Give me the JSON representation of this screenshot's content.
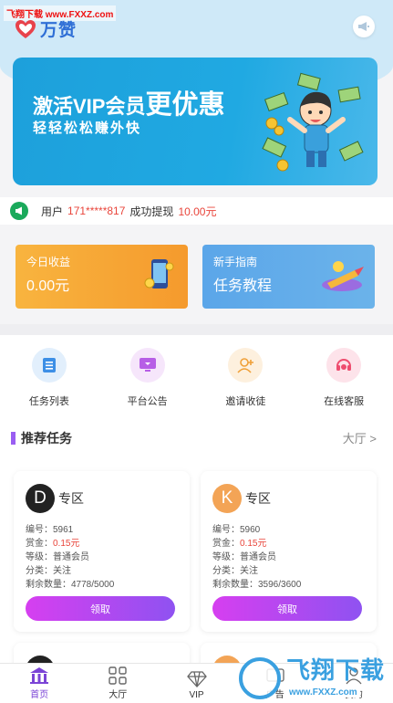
{
  "watermark_top": "飞翔下载 www.FXXZ.com",
  "app": {
    "logo_text": "万赞"
  },
  "banner": {
    "line1_prefix": "激活VIP会员",
    "line1_big": "更优惠",
    "line2": "轻轻松松赚外快"
  },
  "ticker": {
    "user_label": "用户",
    "phone": "171*****817",
    "action": "成功提现",
    "amount": "10.00元"
  },
  "cards": {
    "earnings": {
      "label": "今日收益",
      "value": "0.00元"
    },
    "guide": {
      "label": "新手指南",
      "title": "任务教程"
    }
  },
  "shortcuts": [
    {
      "label": "任务列表",
      "icon": "list-icon",
      "color": "#3d8fe6"
    },
    {
      "label": "平台公告",
      "icon": "monitor-icon",
      "color": "#b75ee6"
    },
    {
      "label": "邀请收徒",
      "icon": "invite-user-icon",
      "color": "#f0a038"
    },
    {
      "label": "在线客服",
      "icon": "headset-icon",
      "color": "#ee4d6f"
    }
  ],
  "recommend": {
    "title": "推荐任务",
    "more": "大厅 >"
  },
  "tasks": [
    {
      "badge": "D",
      "badge_color": "#222222",
      "zone": "专区",
      "id_label": "编号：",
      "id": "5961",
      "reward_label": "赏金：",
      "reward": "0.15元",
      "level_label": "等级：",
      "level": "普通会员",
      "category_label": "分类：",
      "category": "关注",
      "remaining_label": "剩余数量：",
      "remaining": "4778/5000",
      "button": "领取"
    },
    {
      "badge": "K",
      "badge_color": "#f3a456",
      "zone": "专区",
      "id_label": "编号：",
      "id": "5960",
      "reward_label": "赏金：",
      "reward": "0.15元",
      "level_label": "等级：",
      "level": "普通会员",
      "category_label": "分类：",
      "category": "关注",
      "remaining_label": "剩余数量：",
      "remaining": "3596/3600",
      "button": "领取"
    }
  ],
  "tabs": [
    {
      "label": "首页",
      "icon": "home-icon",
      "active": true
    },
    {
      "label": "大厅",
      "icon": "grid-icon",
      "active": false
    },
    {
      "label": "VIP",
      "icon": "diamond-icon",
      "active": false
    },
    {
      "label": "广告",
      "icon": "ad-icon",
      "active": false
    },
    {
      "label": "我的",
      "icon": "user-icon",
      "active": false
    }
  ],
  "watermark_bottom": {
    "cn": "飞翔下载",
    "url": "www.FXXZ.com"
  },
  "colors": {
    "accent": "#7b44d6",
    "banner": "#1da0db",
    "earn_card": "#f8b43f",
    "guide_card": "#5ba6e9",
    "price_red": "#e9453b"
  }
}
